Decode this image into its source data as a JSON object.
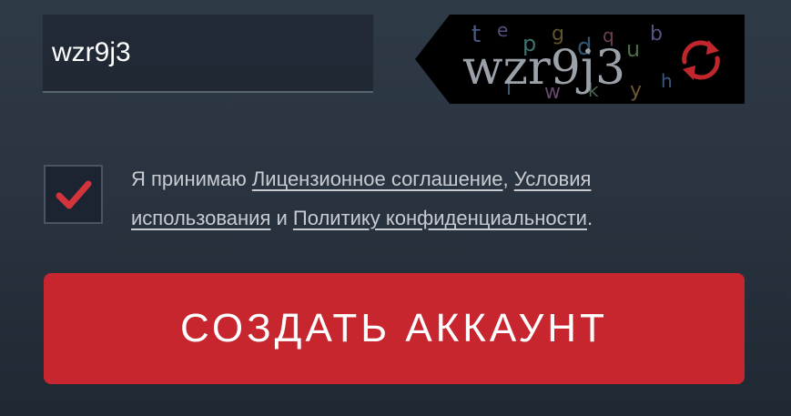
{
  "captcha": {
    "input_value": "wzr9j3",
    "image_text": "wzr9j3",
    "refresh_icon": "refresh-icon",
    "refresh_color": "#c0272d"
  },
  "agreement": {
    "checked": true,
    "check_icon": "checkmark-icon",
    "check_color": "#d4343c",
    "prefix": "Я принимаю ",
    "license_link": "Лицензионное соглашение",
    "sep1": ", ",
    "terms_link": "Условия использования",
    "conj": " и ",
    "privacy_link": "Политику конфиденциальности",
    "suffix": "."
  },
  "submit": {
    "label": "СОЗДАТЬ АККАУНТ",
    "color": "#c7262e"
  }
}
